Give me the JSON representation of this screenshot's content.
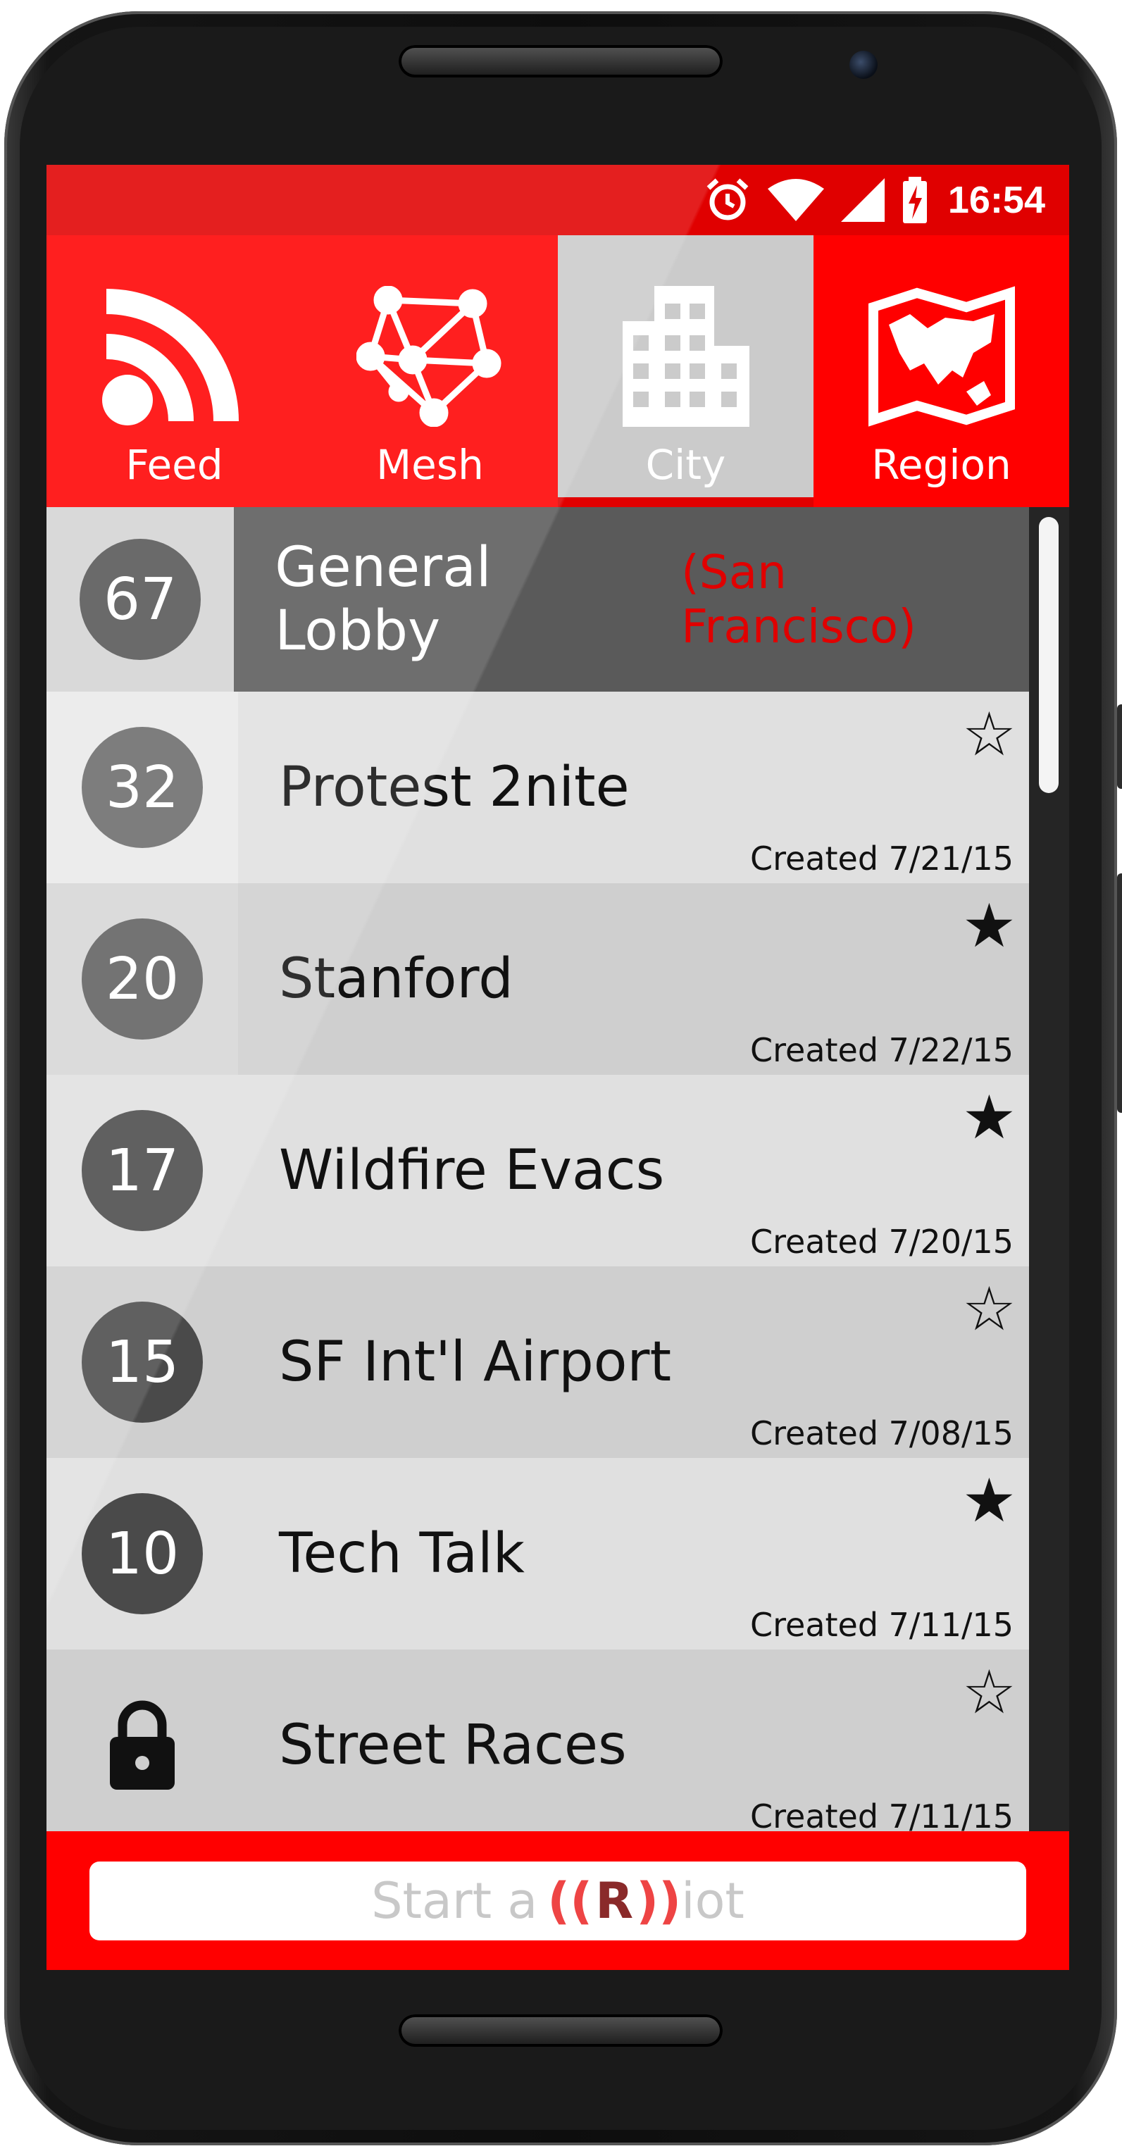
{
  "status_bar": {
    "time": "16:54",
    "icons": [
      "alarm-icon",
      "wifi-icon",
      "signal-icon",
      "battery-charging-icon"
    ]
  },
  "tabs": [
    {
      "label": "Feed",
      "icon": "rss-feed-icon",
      "active": false
    },
    {
      "label": "Mesh",
      "icon": "mesh-network-icon",
      "active": false
    },
    {
      "label": "City",
      "icon": "city-building-icon",
      "active": true
    },
    {
      "label": "Region",
      "icon": "region-map-icon",
      "active": false
    }
  ],
  "lobby": {
    "count": "67",
    "title": "General Lobby",
    "city": "(San Francisco)"
  },
  "rooms": [
    {
      "count": "32",
      "name": "Protest 2nite",
      "created": "Created 7/21/15",
      "starred": false
    },
    {
      "count": "20",
      "name": "Stanford",
      "created": "Created 7/22/15",
      "starred": true
    },
    {
      "count": "17",
      "name": "Wildfire Evacs",
      "created": "Created 7/20/15",
      "starred": true
    },
    {
      "count": "15",
      "name": "SF Int'l Airport",
      "created": "Created 7/08/15",
      "starred": false
    },
    {
      "count": "10",
      "name": "Tech Talk",
      "created": "Created 7/11/15",
      "starred": true
    },
    {
      "count": "",
      "name": "Street Races",
      "created": "Created 7/11/15",
      "starred": false,
      "locked": true
    }
  ],
  "riot_button": {
    "prefix": "Start a",
    "paren_open": "((",
    "r": "R",
    "paren_close": "))",
    "suffix": "iot"
  },
  "colors": {
    "accent": "#ff0000",
    "status_bar": "#e00000",
    "active_tab": "#cbcbcb",
    "lobby_bg": "#5a5a5a",
    "badge": "#555555"
  }
}
